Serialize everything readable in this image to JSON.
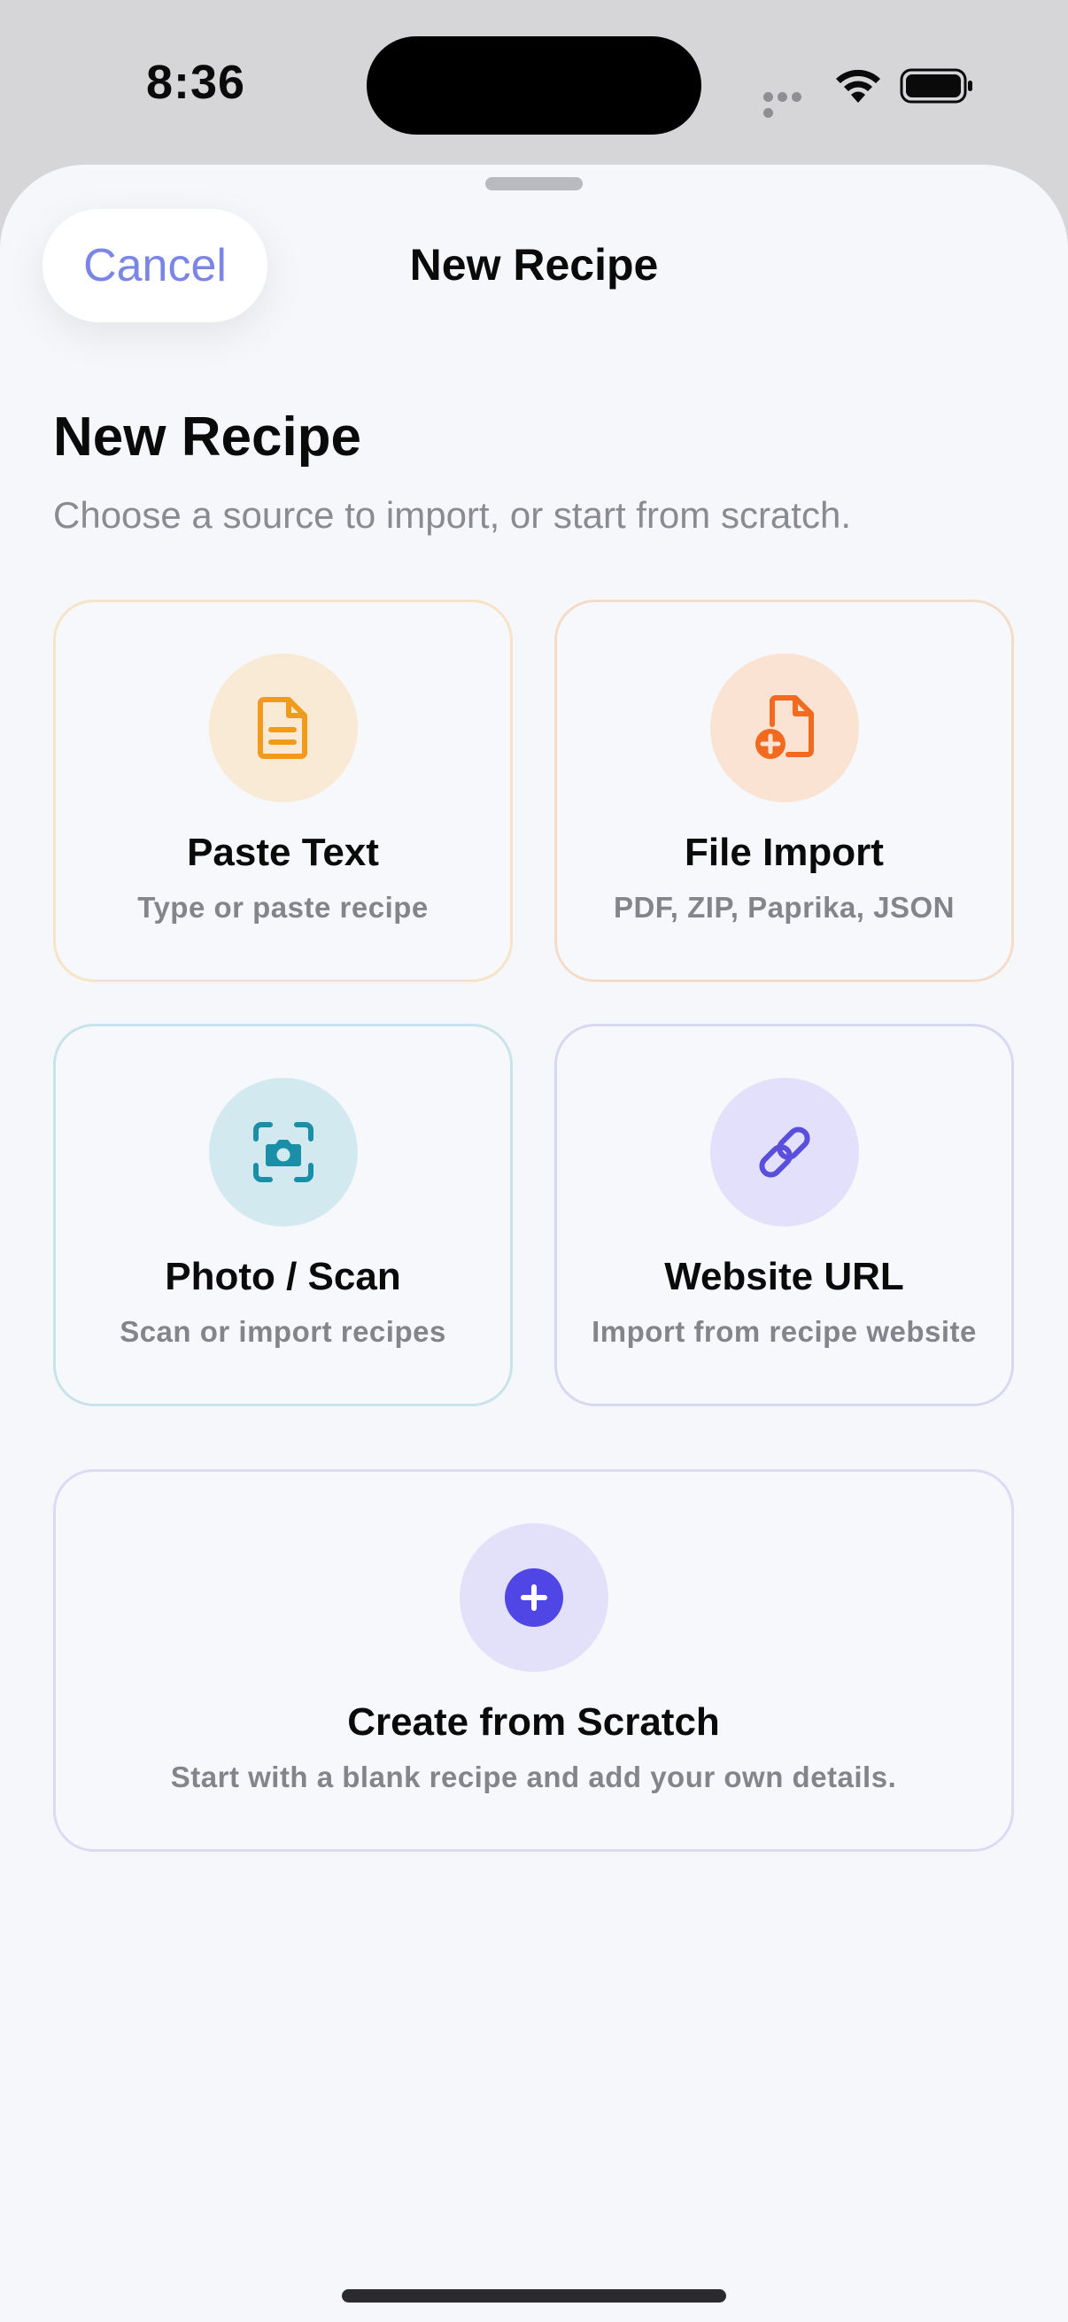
{
  "status_bar": {
    "time": "8:36"
  },
  "nav": {
    "cancel_label": "Cancel",
    "title": "New Recipe"
  },
  "header": {
    "title": "New Recipe",
    "subtitle": "Choose a source to import, or start from scratch."
  },
  "options": [
    {
      "title": "Paste Text",
      "description": "Type or paste recipe",
      "icon": "document-text-icon",
      "accent": "#f29a1a"
    },
    {
      "title": "File Import",
      "description": "PDF, ZIP, Paprika, JSON",
      "icon": "file-add-icon",
      "accent": "#f26a1f"
    },
    {
      "title": "Photo / Scan",
      "description": "Scan or import recipes",
      "icon": "camera-scan-icon",
      "accent": "#1c8fa8"
    },
    {
      "title": "Website URL",
      "description": "Import from recipe website",
      "icon": "link-icon",
      "accent": "#5a4fdc"
    }
  ],
  "scratch": {
    "title": "Create from Scratch",
    "description": "Start with a blank recipe and add your own details.",
    "icon": "plus-circle-icon",
    "accent": "#4f46e5"
  },
  "colors": {
    "cancel_text": "#7a85e6",
    "sheet_background": "#f6f7fa"
  }
}
